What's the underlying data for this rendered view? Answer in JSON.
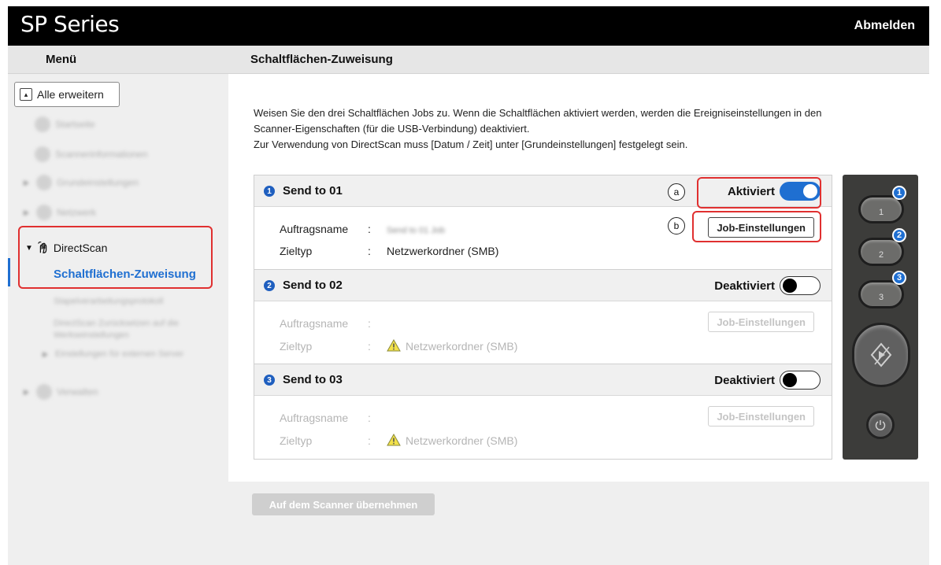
{
  "app": {
    "title": "SP Series",
    "logout_label": "Abmelden"
  },
  "header": {
    "menu_title": "Menü",
    "page_title": "Schaltflächen-Zuweisung"
  },
  "sidebar": {
    "expand_all_label": "Alle erweitern",
    "items": [
      {
        "label": "Startseite"
      },
      {
        "label": "Scannerinformationen"
      },
      {
        "label": "Grundeinstellungen"
      },
      {
        "label": "Netzwerk"
      },
      {
        "label": "DirectScan"
      },
      {
        "label": "Schaltflächen-Zuweisung"
      },
      {
        "label": "Stapelverarbeitungsprotokoll"
      },
      {
        "label": "DirectScan Zurücksetzen auf die Werkseinstellungen"
      },
      {
        "label": "Einstellungen für externen Server"
      },
      {
        "label": "Verwalten"
      }
    ]
  },
  "intro": {
    "line1": "Weisen Sie den drei Schaltflächen Jobs zu. Wenn die Schaltflächen aktiviert werden, werden die Ereigniseinstellungen in den",
    "line2": "Scanner-Eigenschaften (für die USB-Verbindung) deaktiviert.",
    "line3": "Zur Verwendung von DirectScan muss [Datum / Zeit] unter [Grundeinstellungen] festgelegt sein."
  },
  "markers": {
    "a": "a",
    "b": "b"
  },
  "slots": [
    {
      "number": "1",
      "title": "Send to 01",
      "status": "Aktiviert",
      "enabled": true,
      "job_name_label": "Auftragsname",
      "job_name_value": "Send to 01 Job",
      "dest_label": "Zieltyp",
      "dest_value": "Netzwerkordner (SMB)",
      "job_button": "Job-Einstellungen",
      "colon": ":"
    },
    {
      "number": "2",
      "title": "Send to 02",
      "status": "Deaktiviert",
      "enabled": false,
      "job_name_label": "Auftragsname",
      "job_name_value": "",
      "dest_label": "Zieltyp",
      "dest_value": "Netzwerkordner (SMB)",
      "job_button": "Job-Einstellungen",
      "colon": ":"
    },
    {
      "number": "3",
      "title": "Send to 03",
      "status": "Deaktiviert",
      "enabled": false,
      "job_name_label": "Auftragsname",
      "job_name_value": "",
      "dest_label": "Zieltyp",
      "dest_value": "Netzwerkordner (SMB)",
      "job_button": "Job-Einstellungen",
      "colon": ":"
    }
  ],
  "apply_button": "Auf dem Scanner übernehmen",
  "scanner": {
    "buttons": [
      {
        "label": "1",
        "badge": "1"
      },
      {
        "label": "2",
        "badge": "2"
      },
      {
        "label": "3",
        "badge": "3"
      }
    ]
  },
  "colors": {
    "accent": "#1f6fd1",
    "highlight": "#e03030",
    "topbar": "#000000"
  },
  "icons": [
    "home-icon",
    "info-icon",
    "gear-icon",
    "network-icon",
    "hand-scan-icon",
    "tools-icon",
    "warning-icon",
    "scan-start-icon",
    "power-icon"
  ]
}
